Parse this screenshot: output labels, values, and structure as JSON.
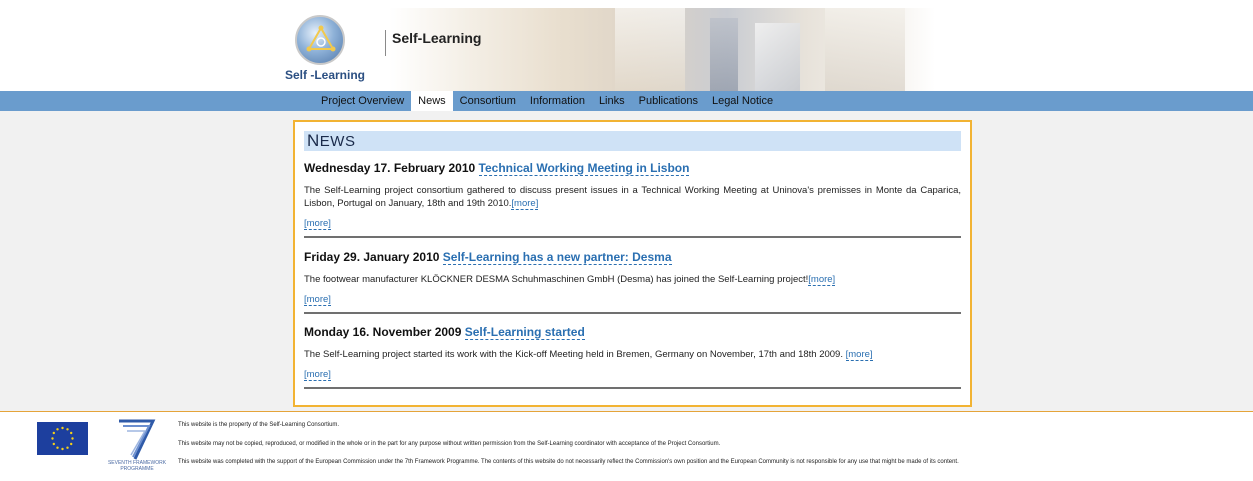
{
  "header": {
    "logo_text": "Self -Learning",
    "site_title": "Self-Learning"
  },
  "nav": {
    "items": [
      {
        "label": "Project Overview"
      },
      {
        "label": "News"
      },
      {
        "label": "Consortium"
      },
      {
        "label": "Information"
      },
      {
        "label": "Links"
      },
      {
        "label": "Publications"
      },
      {
        "label": "Legal Notice"
      }
    ],
    "active": "News"
  },
  "news": {
    "heading_cap": "N",
    "heading_rest": "EWS",
    "items": [
      {
        "date": "Wednesday 17. February 2010",
        "title": "Technical Working Meeting in Lisbon",
        "text": "The Self-Learning project consortium gathered to discuss present issues in a Technical Working Meeting at Uninova's premisses in Monte da Caparica, Lisbon, Portugal on January, 18th and 19th 2010.",
        "inline_more": "[more]",
        "more": "[more]"
      },
      {
        "date": "Friday 29. January 2010",
        "title": "Self-Learning has a new partner: Desma",
        "text": "The footwear manufacturer KLÖCKNER DESMA Schuhmaschinen GmbH (Desma) has joined the Self-Learning project!",
        "inline_more": "[more]",
        "more": "[more]"
      },
      {
        "date": "Monday 16. November 2009",
        "title": "Self-Learning started",
        "text": "The Self-Learning project started its work with the Kick-off Meeting held in Bremen, Germany on November, 17th and 18th 2009. ",
        "inline_more": "[more]",
        "more": "[more]"
      }
    ]
  },
  "footer": {
    "fp7_label": "SEVENTH FRAMEWORK PROGRAMME",
    "lines": [
      "This website is the property of the Self-Learning Consortium.",
      "This website may not be copied, reproduced, or modified in the whole or in the part for any purpose without written permission from the Self-Learning coordinator with acceptance of the Project Consortium.",
      "This website was completed with the support of the European Commission under the 7th Framework Programme. The contents of this website do not necessarily reflect the Commission's own position and the European Community is not responsible for any use that might be made of its content."
    ]
  },
  "colors": {
    "nav_bar": "#6a9ccd",
    "content_border": "#f2b333",
    "news_heading_bg": "#cfe2f6",
    "link": "#2a6fb1",
    "eu_blue": "#1d3f9e"
  }
}
